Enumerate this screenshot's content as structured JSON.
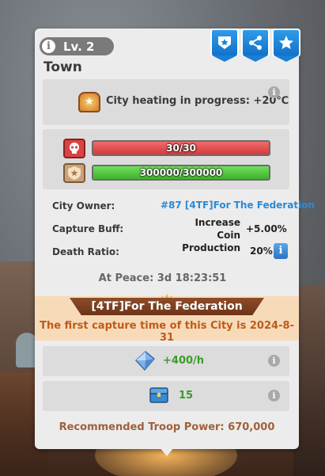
{
  "header": {
    "level": "Lv. 2",
    "title": "Town"
  },
  "heating": {
    "text": "City heating in progress: +20℃"
  },
  "bars": [
    {
      "value": "30/30",
      "fill": 1.0,
      "color": "#e64848",
      "icon": "skull-icon"
    },
    {
      "value": "300000/300000",
      "fill": 1.0,
      "color": "#4cc93a",
      "icon": "shield-star-icon"
    }
  ],
  "city_info": {
    "owner_label": "City Owner:",
    "owner_value": "#87 [4TF]For The Federation",
    "buff_label": "Capture Buff:",
    "buff_line1": "Increase Coin",
    "buff_line2": "Production",
    "buff_value": "+5.00%",
    "death_label": "Death Ratio:",
    "death_value": "20%"
  },
  "peace": "At Peace: 3d 18:23:51",
  "alliance": {
    "banner": "[4TF]For The Federation",
    "capture_text": "The first capture time of this City is 2024-8-31"
  },
  "rewards": [
    {
      "icon": "crystal-icon",
      "value": "+400/h"
    },
    {
      "icon": "chest-icon",
      "value": "15"
    }
  ],
  "recommended": "Recommended Troop Power: 670,000",
  "colors": {
    "accent_blue": "#1a7fd6",
    "owner_link": "#2a8ad8",
    "capture_orange": "#c05a1a"
  }
}
